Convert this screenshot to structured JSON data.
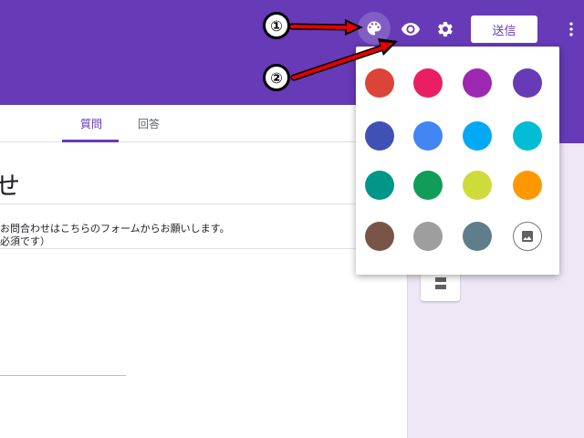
{
  "header": {
    "send_label": "送信",
    "icons": [
      "palette-icon",
      "eye-icon",
      "gear-icon",
      "more-vert-icon"
    ]
  },
  "tabs": [
    {
      "label": "質問",
      "active": true
    },
    {
      "label": "回答",
      "active": false
    }
  ],
  "form": {
    "title": "せ",
    "description": "お問合わせはこちらのフォームからお願いします。\n必須です）"
  },
  "palette": {
    "colors": [
      "#db4437",
      "#e91e63",
      "#9c27b0",
      "#673ab7",
      "#3f51b5",
      "#4285f4",
      "#03a9f4",
      "#00bcd4",
      "#009688",
      "#0f9d58",
      "#cddc39",
      "#ff9800",
      "#795548",
      "#9e9e9e",
      "#607d8b"
    ],
    "image_icon": "image-icon"
  },
  "annotations": [
    "①",
    "②"
  ],
  "colors": {
    "theme": "#673ab7",
    "background": "#ede7f6",
    "arrow": "#e60000"
  }
}
